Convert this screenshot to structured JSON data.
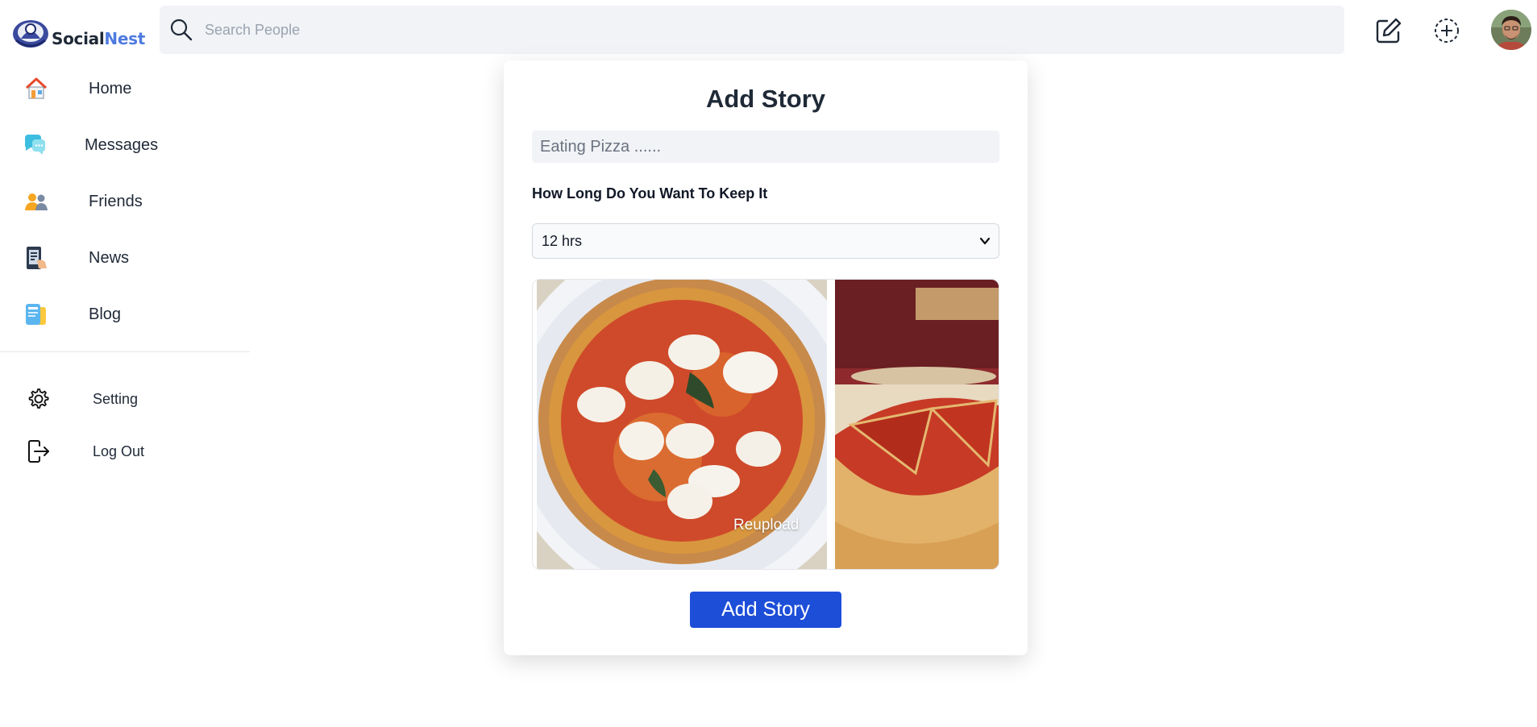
{
  "brand": {
    "name_part1": "Social",
    "name_part2": "Nest",
    "accent": "#4f7be0"
  },
  "search": {
    "placeholder": "Search People",
    "icon": "search-icon"
  },
  "header_actions": [
    {
      "name": "edit-icon"
    },
    {
      "name": "add-circle-icon"
    },
    {
      "name": "user-avatar"
    }
  ],
  "sidebar": {
    "items": [
      {
        "label": "Home",
        "icon": "home-icon"
      },
      {
        "label": "Messages",
        "icon": "messages-icon"
      },
      {
        "label": "Friends",
        "icon": "friends-icon"
      },
      {
        "label": "News",
        "icon": "news-icon"
      },
      {
        "label": "Blog",
        "icon": "blog-icon"
      }
    ],
    "secondary": [
      {
        "label": "Setting",
        "icon": "gear-icon"
      },
      {
        "label": "Log Out",
        "icon": "logout-icon"
      }
    ]
  },
  "story_form": {
    "title": "Add Story",
    "text_value": "Eating Pizza ......",
    "duration_label": "How Long Do You Want To Keep It",
    "duration_selected": "12 hrs",
    "images": [
      {
        "name": "margherita-pizza-image"
      },
      {
        "name": "deep-dish-pizza-image"
      }
    ],
    "reupload_label": "Reupload",
    "submit_label": "Add Story",
    "submit_color": "#1d4ed8"
  }
}
